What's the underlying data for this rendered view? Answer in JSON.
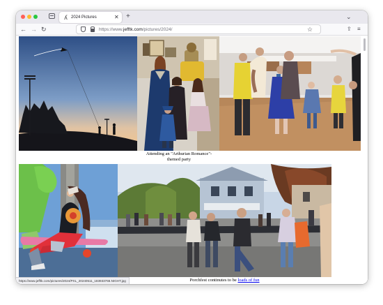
{
  "colors": {
    "close_light": "#ff5f57",
    "minimize_light": "#febc2e",
    "zoom_light": "#28c840",
    "link": "#0000ee"
  },
  "tab": {
    "icon": "jeff-favicon-icon",
    "title": "2024 Pictures",
    "close_glyph": "✕"
  },
  "toolbar": {
    "back_glyph": "←",
    "forward_glyph": "→",
    "reload_glyph": "↻",
    "new_tab_glyph": "+",
    "tab_list_glyph": "⌄",
    "bookmark_glyph": "☆",
    "extensions_glyph": "⇪",
    "menu_glyph": "≡"
  },
  "address": {
    "prefix": "https://www.",
    "domain": "jefftk.com",
    "path": "/pictures/2024/"
  },
  "gallery": {
    "caption_1": "Attending an \"Arthurian Romance\"-themed party",
    "caption_2_text": "Porchfest continutes to be ",
    "caption_2_link": "loads of fun"
  },
  "status_url": "https://www.jefftk.com/pictures/2024/PXL_20240511_183933766.NIGHT.jpg"
}
